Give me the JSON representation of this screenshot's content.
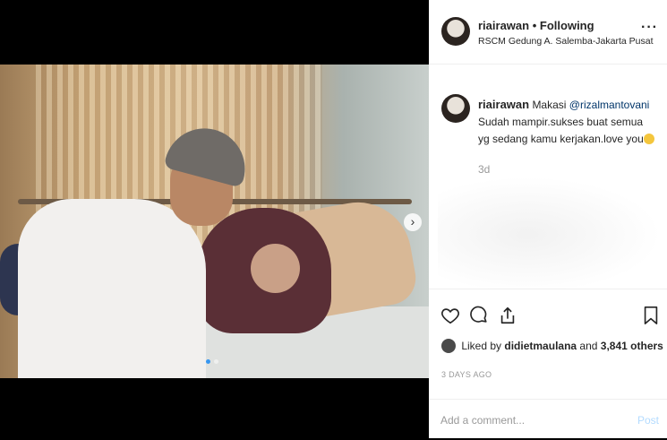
{
  "header": {
    "username": "riairawan",
    "separator": "•",
    "follow_status": "Following",
    "location": "RSCM Gedung A. Salemba-Jakarta Pusat",
    "more_label": "···"
  },
  "comment": {
    "username": "riairawan",
    "text_before": "Makasi",
    "mention": "@rizalmantovani",
    "text_after": "Sudah mampir.sukses buat semua yg sedang kamu kerjakan.love you",
    "emoji": "kissing-emoji",
    "time": "3d"
  },
  "carousel": {
    "next_label": "›",
    "slide_count": 2,
    "active_index": 0
  },
  "actions": {
    "icons": [
      "heart-icon",
      "comment-icon",
      "share-icon",
      "bookmark-icon"
    ]
  },
  "likes": {
    "prefix": "Liked by",
    "user": "didietmaulana",
    "conj": "and",
    "others": "3,841 others"
  },
  "date": "3 DAYS AGO",
  "add_comment": {
    "placeholder": "Add a comment...",
    "post_label": "Post",
    "post_color": "#b3dbff"
  },
  "colors": {
    "accent": "#3897f0",
    "text": "#262626",
    "muted": "#999999"
  }
}
